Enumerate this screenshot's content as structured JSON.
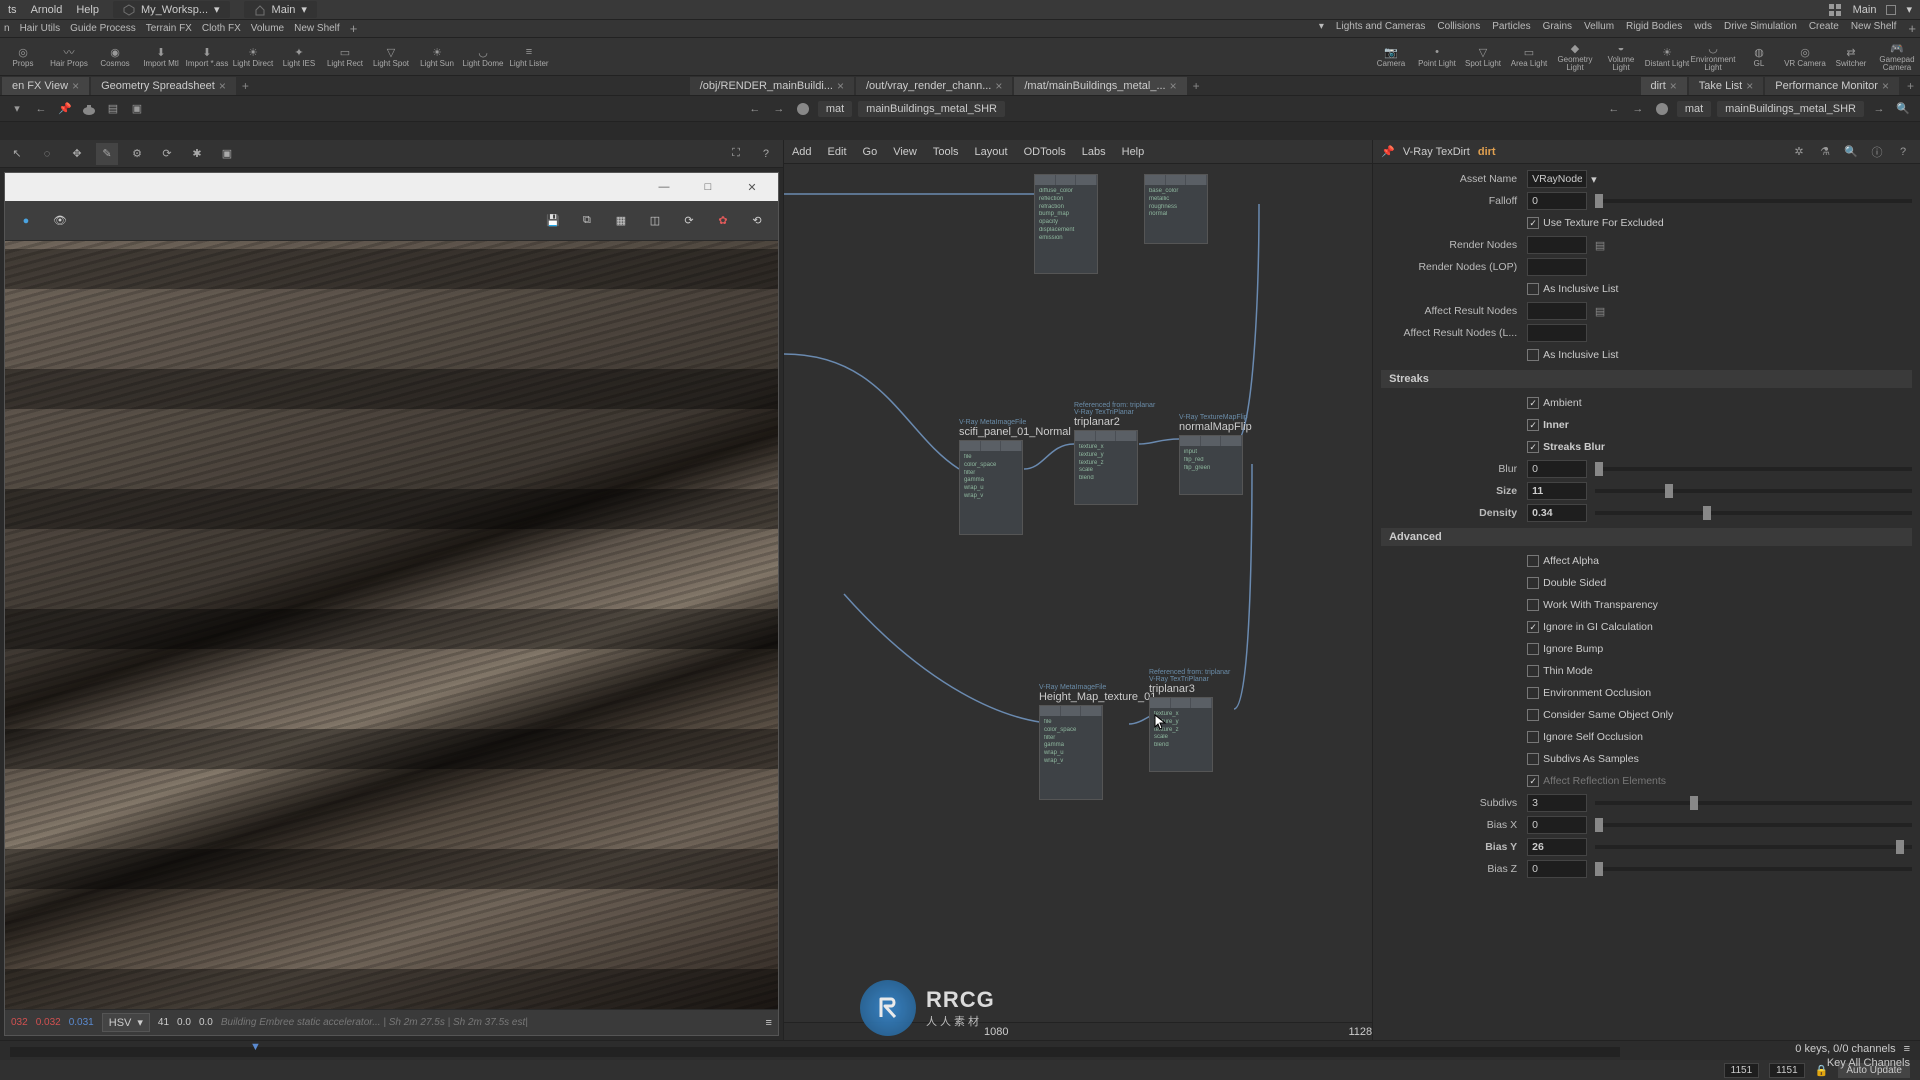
{
  "menubar": {
    "m0": "ts",
    "m1": "Arnold",
    "m2": "Help",
    "workspace": "My_Worksp...",
    "main": "Main",
    "rightMain": "Main"
  },
  "shelves": {
    "l0": "n",
    "l1": "Hair Utils",
    "l2": "Guide Process",
    "l3": "Terrain FX",
    "l4": "Cloth FX",
    "l5": "Volume",
    "l6": "New Shelf",
    "r0": "Lights and Cameras",
    "r1": "Collisions",
    "r2": "Particles",
    "r3": "Grains",
    "r4": "Vellum",
    "r5": "Rigid Bodies",
    "r6": "wds",
    "r7": "Drive Simulation",
    "r8": "Create",
    "r9": "New Shelf"
  },
  "shelf_items_left": [
    {
      "label": "Props",
      "icon": "cube"
    },
    {
      "label": "Hair Props",
      "icon": "hair"
    },
    {
      "label": "Cosmos",
      "icon": "globe"
    },
    {
      "label": "Import Mtl",
      "icon": "down"
    },
    {
      "label": "Import *.ass",
      "icon": "down"
    },
    {
      "label": "Light Direct",
      "icon": "sun"
    },
    {
      "label": "Light IES",
      "icon": "bulb"
    },
    {
      "label": "Light Rect",
      "icon": "rect"
    },
    {
      "label": "Light Spot",
      "icon": "cone"
    },
    {
      "label": "Light Sun",
      "icon": "sun"
    },
    {
      "label": "Light Dome",
      "icon": "dome"
    },
    {
      "label": "Light Lister",
      "icon": "list"
    }
  ],
  "shelf_items_right": [
    {
      "label": "Camera",
      "icon": "cam"
    },
    {
      "label": "Point Light",
      "icon": "pt"
    },
    {
      "label": "Spot Light",
      "icon": "cone"
    },
    {
      "label": "Area Light",
      "icon": "rect"
    },
    {
      "label": "Geometry Light",
      "icon": "geo"
    },
    {
      "label": "Volume Light",
      "icon": "vol"
    },
    {
      "label": "Distant Light",
      "icon": "sun"
    },
    {
      "label": "Environment Light",
      "icon": "dome"
    },
    {
      "label": "GL",
      "icon": "gl"
    },
    {
      "label": "VR Camera",
      "icon": "vr"
    },
    {
      "label": "Switcher",
      "icon": "sw"
    },
    {
      "label": "Gamepad Camera",
      "icon": "pad"
    }
  ],
  "paneltabs": {
    "left": [
      {
        "label": "en FX View"
      },
      {
        "label": "Geometry Spreadsheet"
      }
    ],
    "mid": [
      {
        "label": "/obj/RENDER_mainBuildi..."
      },
      {
        "label": "/out/vray_render_chann..."
      },
      {
        "label": "/mat/mainBuildings_metal_..."
      }
    ],
    "right": [
      {
        "label": "dirt"
      },
      {
        "label": "Take List"
      },
      {
        "label": "Performance Monitor"
      }
    ]
  },
  "path": {
    "leftcrumb": "",
    "mid_root": "mat",
    "mid_node": "mainBuildings_metal_SHR",
    "right_root": "mat",
    "right_node": "mainBuildings_metal_SHR"
  },
  "nodemenu": {
    "m0": "Add",
    "m1": "Edit",
    "m2": "Go",
    "m3": "View",
    "m4": "Tools",
    "m5": "Layout",
    "m6": "ODTools",
    "m7": "Labs",
    "m8": "Help"
  },
  "nodes": {
    "n1": {
      "type": "V-Ray MetaImageFile",
      "name": "scifi_panel_01_Normal"
    },
    "n2": {
      "type": "V-Ray TexTriPlanar",
      "name": "triplanar2",
      "ref": "Referenced from: triplanar"
    },
    "n3": {
      "type": "V-Ray TextureMapFlip",
      "name": "normalMapFlip"
    },
    "n4": {
      "type": "V-Ray MetaImageFile",
      "name": "Height_Map_texture_01"
    },
    "n5": {
      "type": "V-Ray TexTriPlanar",
      "name": "triplanar3",
      "ref": "Referenced from: triplanar"
    }
  },
  "ticks": {
    "a": "1080",
    "b": "1128"
  },
  "param": {
    "typeLabel": "V-Ray TexDirt",
    "nodeName": "dirt",
    "assetNameLbl": "Asset Name",
    "assetNameVal": "VRayNodeTexDirt",
    "falloffLbl": "Falloff",
    "falloffVal": "0",
    "useTexExLbl": "Use Texture For Excluded",
    "renderNodesLbl": "Render Nodes",
    "renderNodesLopLbl": "Render Nodes (LOP)",
    "inclListLbl": "As Inclusive List",
    "affectResLbl": "Affect Result Nodes",
    "affectResLopLbl": "Affect Result Nodes (L...",
    "streaksHdr": "Streaks",
    "ambientLbl": "Ambient",
    "innerLbl": "Inner",
    "streaksBlurLbl": "Streaks Blur",
    "blurLbl": "Blur",
    "blurVal": "0",
    "sizeLbl": "Size",
    "sizeVal": "11",
    "densityLbl": "Density",
    "densityVal": "0.34",
    "advHdr": "Advanced",
    "affectAlphaLbl": "Affect Alpha",
    "doubleSidedLbl": "Double Sided",
    "workTranspLbl": "Work With Transparency",
    "ignoreGILbl": "Ignore in GI Calculation",
    "ignoreBumpLbl": "Ignore Bump",
    "thinModeLbl": "Thin Mode",
    "envOcclLbl": "Environment Occlusion",
    "sameObjLbl": "Consider Same Object Only",
    "ignoreSelfLbl": "Ignore Self Occlusion",
    "subdivsSampLbl": "Subdivs As Samples",
    "affectReflLbl": "Affect Reflection Elements",
    "subdivsLbl": "Subdivs",
    "subdivsVal": "3",
    "biasXLbl": "Bias X",
    "biasXVal": "0",
    "biasYLbl": "Bias Y",
    "biasYVal": "26",
    "biasZLbl": "Bias Z",
    "biasZVal": "0"
  },
  "vfb": {
    "c0": "032",
    "c1": "0.032",
    "c2": "0.031",
    "colormode": "HSV",
    "n0": "41",
    "n1": "0.0",
    "n2": "0.0",
    "statusmsg": "Building Embree static accelerator... | Sh  2m 27.5s | Sh  2m 37.5s est|"
  },
  "timeline": {
    "keys": "0 keys, 0/0 channels",
    "keyall": "Key All Channels",
    "f1": "1151",
    "f2": "1151",
    "auto": "Auto Update"
  },
  "watermark": {
    "big": "RRCG",
    "small": "人人素材"
  }
}
